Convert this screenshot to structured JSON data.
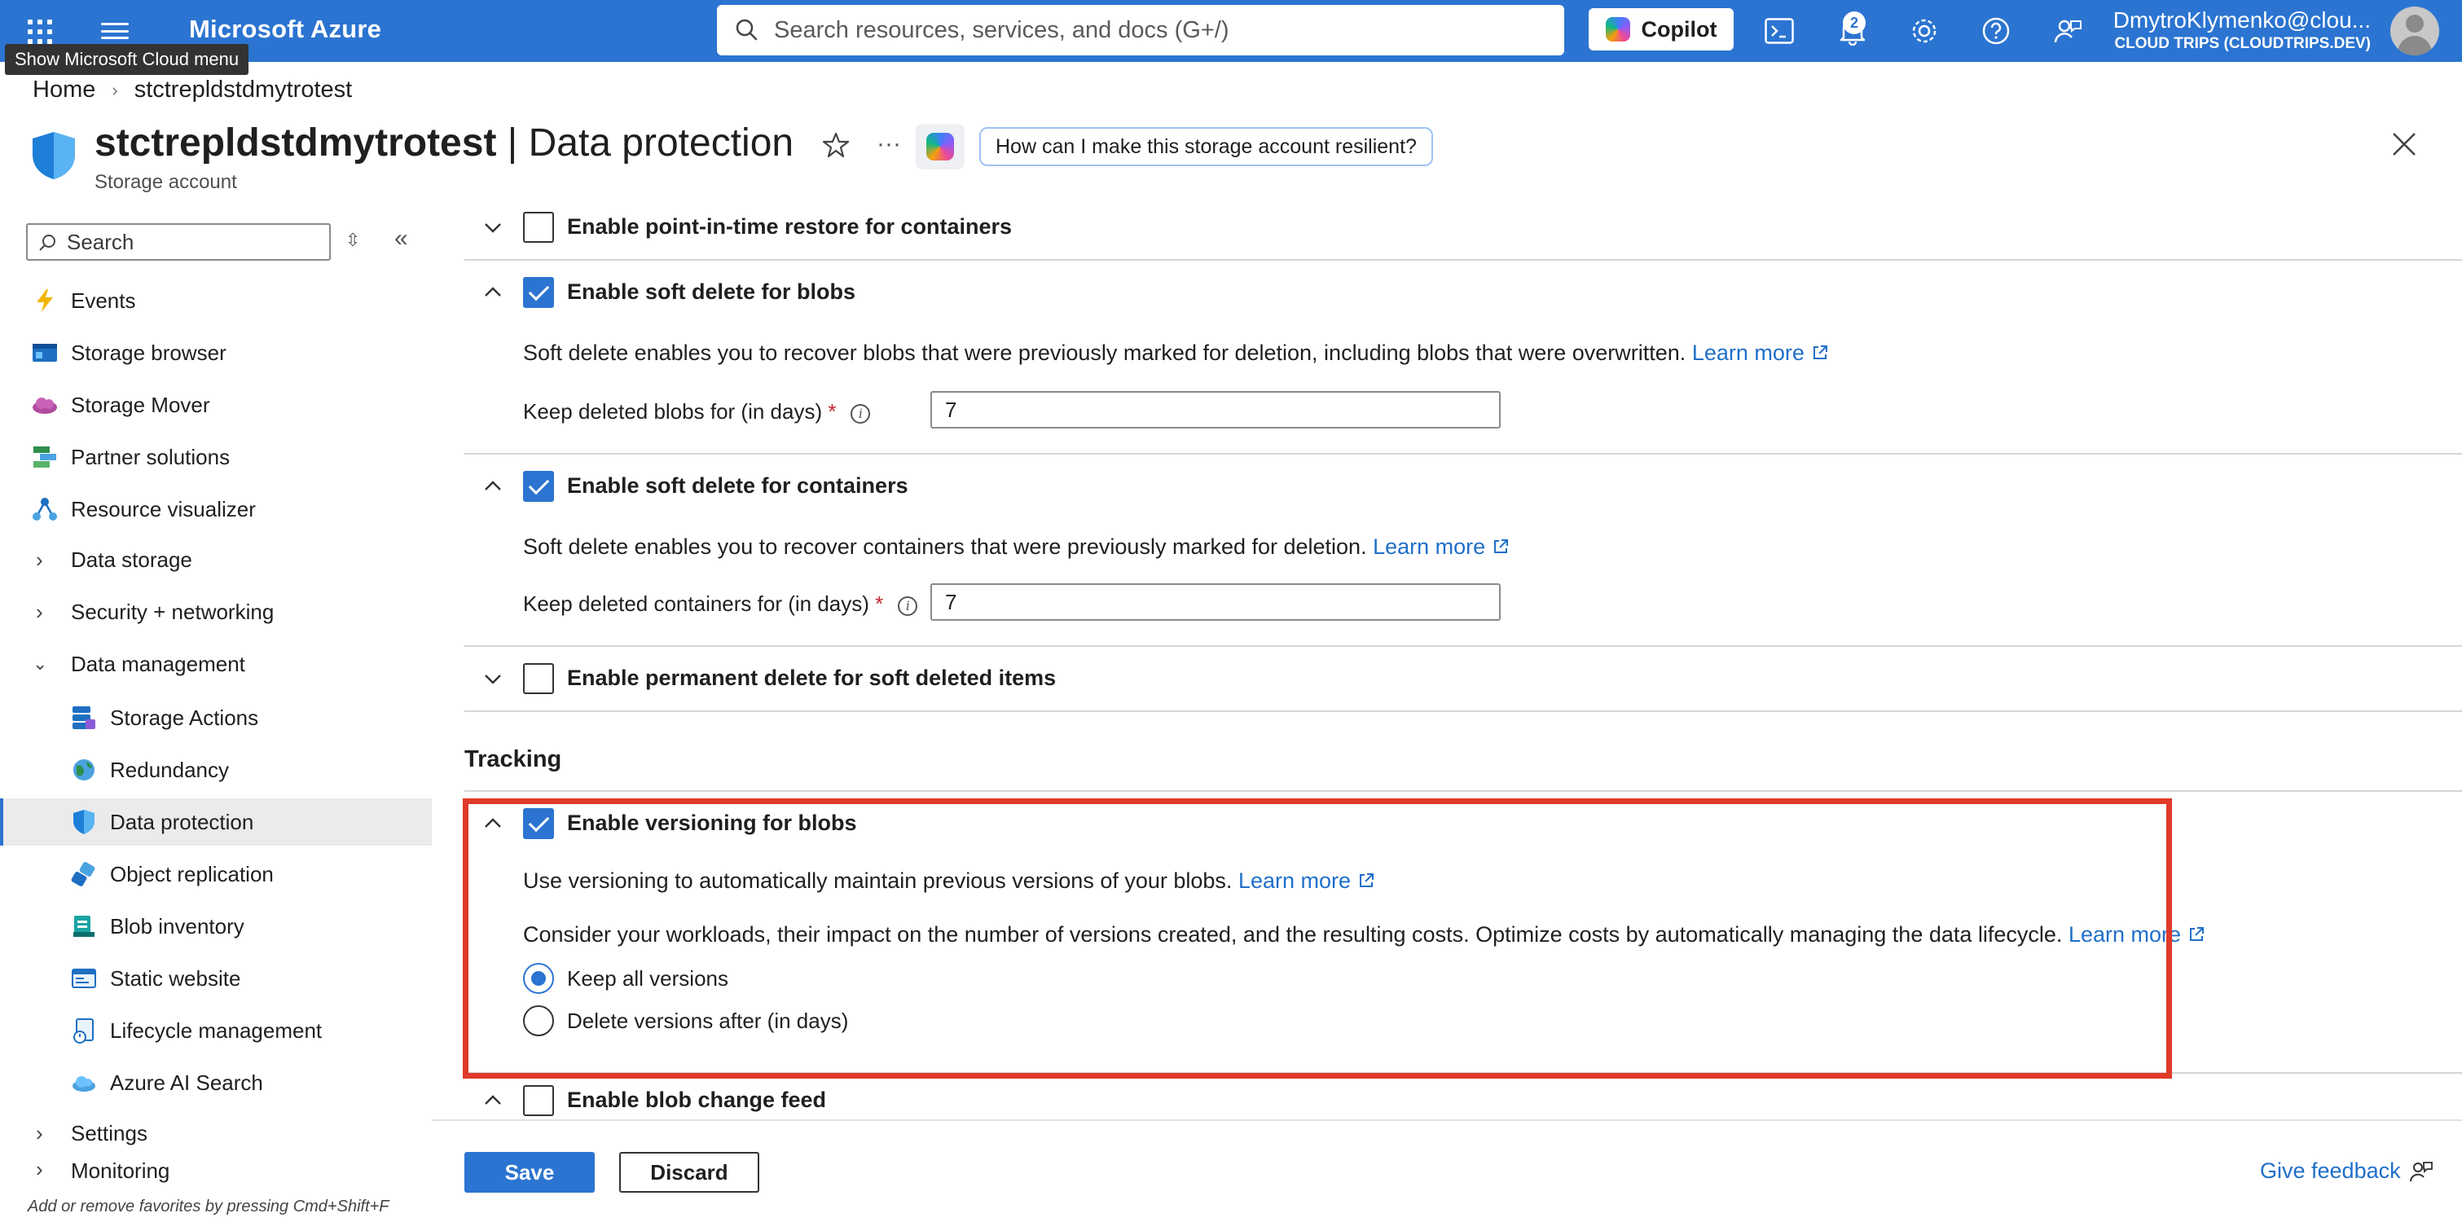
{
  "topbar": {
    "brand": "Microsoft Azure",
    "search_placeholder": "Search resources, services, and docs (G+/)",
    "copilot_label": "Copilot",
    "notification_count": "2",
    "user_name": "DmytroKlymenko@clou...",
    "user_org": "CLOUD TRIPS (CLOUDTRIPS.DEV)",
    "tooltip": "Show Microsoft Cloud menu"
  },
  "breadcrumb": {
    "home": "Home",
    "current": "stctrepldstdmytrotest"
  },
  "header": {
    "resource_name": "stctrepldstdmytrotest",
    "separator": " | ",
    "page_name": "Data protection",
    "subtitle": "Storage account",
    "more": "···",
    "copilot_prompt": "How can I make this storage account resilient?"
  },
  "sidebar": {
    "search_placeholder": "Search",
    "items": [
      {
        "label": "Events",
        "icon": "lightning-icon"
      },
      {
        "label": "Storage browser",
        "icon": "storage-browser-icon"
      },
      {
        "label": "Storage Mover",
        "icon": "cloud-mover-icon"
      },
      {
        "label": "Partner solutions",
        "icon": "partner-icon"
      },
      {
        "label": "Resource visualizer",
        "icon": "visualizer-icon"
      },
      {
        "label": "Data storage",
        "icon": "chevron-right-icon"
      },
      {
        "label": "Security + networking",
        "icon": "chevron-right-icon"
      },
      {
        "label": "Data management",
        "icon": "chevron-down-icon"
      },
      {
        "label": "Storage Actions",
        "icon": "storage-actions-icon"
      },
      {
        "label": "Redundancy",
        "icon": "globe-icon"
      },
      {
        "label": "Data protection",
        "icon": "shield-icon"
      },
      {
        "label": "Object replication",
        "icon": "replication-icon"
      },
      {
        "label": "Blob inventory",
        "icon": "inventory-icon"
      },
      {
        "label": "Static website",
        "icon": "website-icon"
      },
      {
        "label": "Lifecycle management",
        "icon": "lifecycle-icon"
      },
      {
        "label": "Azure AI Search",
        "icon": "ai-search-icon"
      },
      {
        "label": "Settings",
        "icon": "chevron-right-icon"
      },
      {
        "label": "Monitoring",
        "icon": "chevron-right-icon"
      }
    ],
    "favorites_hint": "Add or remove favorites by pressing Cmd+Shift+F"
  },
  "content": {
    "pitr": {
      "label": "Enable point-in-time restore for containers",
      "checked": false
    },
    "soft_delete_blobs": {
      "label": "Enable soft delete for blobs",
      "checked": true,
      "description": "Soft delete enables you to recover blobs that were previously marked for deletion, including blobs that were overwritten.",
      "learn_more": "Learn more",
      "field_label": "Keep deleted blobs for (in days)",
      "required": "*",
      "value": "7"
    },
    "soft_delete_containers": {
      "label": "Enable soft delete for containers",
      "checked": true,
      "description": "Soft delete enables you to recover containers that were previously marked for deletion.",
      "learn_more": "Learn more",
      "field_label": "Keep deleted containers for (in days)",
      "required": "*",
      "value": "7"
    },
    "permanent_delete": {
      "label": "Enable permanent delete for soft deleted items",
      "checked": false
    },
    "tracking_title": "Tracking",
    "versioning": {
      "label": "Enable versioning for blobs",
      "checked": true,
      "description": "Use versioning to automatically maintain previous versions of your blobs.",
      "learn_more": "Learn more",
      "consider": "Consider your workloads, their impact on the number of versions created, and the resulting costs. Optimize costs by automatically managing the data lifecycle.",
      "consider_learn_more": "Learn more",
      "option_keep": "Keep all versions",
      "option_delete": "Delete versions after (in days)",
      "selected": "Keep all versions"
    },
    "change_feed": {
      "label": "Enable blob change feed",
      "checked": false
    }
  },
  "footer": {
    "save": "Save",
    "discard": "Discard",
    "feedback": "Give feedback"
  },
  "colors": {
    "accent": "#2b74d1",
    "highlight": "#e03a2a",
    "link": "#1f6fc9"
  }
}
